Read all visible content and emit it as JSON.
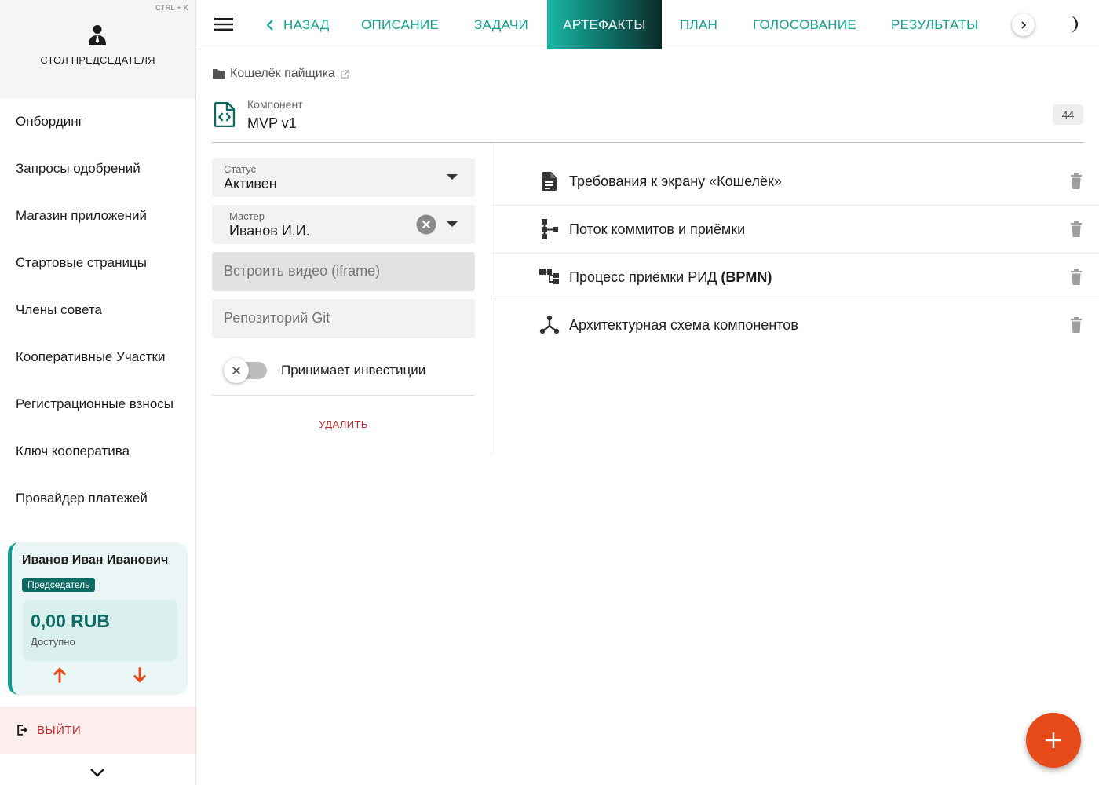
{
  "colors": {
    "accent": "#11a393",
    "accent_dark": "#0d6b63",
    "danger": "#c62828",
    "fab": "#e64a19"
  },
  "sidebar": {
    "hotkey": "CTRL + K",
    "header_icon": "user-tie-icon",
    "title": "СТОЛ ПРЕДСЕДАТЕЛЯ",
    "items": [
      {
        "label": "Онбординг"
      },
      {
        "label": "Запросы одобрений"
      },
      {
        "label": "Магазин приложений"
      },
      {
        "label": "Стартовые страницы"
      },
      {
        "label": "Члены совета"
      },
      {
        "label": "Кооперативные Участки"
      },
      {
        "label": "Регистрационные взносы"
      },
      {
        "label": "Ключ кооператива"
      },
      {
        "label": "Провайдер платежей"
      }
    ],
    "user": {
      "name": "Иванов Иван Иванович",
      "role": "Председатель",
      "balance": "0,00 RUB",
      "balance_caption": "Доступно"
    },
    "logout_label": "ВЫЙТИ"
  },
  "topbar": {
    "tabs": [
      {
        "label": "НАЗАД"
      },
      {
        "label": "ОПИСАНИЕ"
      },
      {
        "label": "ЗАДАЧИ"
      },
      {
        "label": "АРТЕФАКТЫ",
        "active": true
      },
      {
        "label": "ПЛАН"
      },
      {
        "label": "ГОЛОСОВАНИЕ"
      },
      {
        "label": "РЕЗУЛЬТАТЫ"
      }
    ]
  },
  "breadcrumb": {
    "label": "Кошелёк пайщика"
  },
  "component": {
    "caption": "Компонент",
    "name": "MVP v1",
    "count": "44"
  },
  "form": {
    "status": {
      "label": "Статус",
      "value": "Активен"
    },
    "master": {
      "label": "Мастер",
      "value": "Иванов И.И."
    },
    "video": {
      "placeholder": "Встроить видео (iframe)"
    },
    "repo": {
      "placeholder": "Репозиторий Git"
    },
    "investments_label": "Принимает инвестиции",
    "investments_on": false,
    "delete_label": "УДАЛИТЬ"
  },
  "artifacts": [
    {
      "icon": "document-icon",
      "title": "Требования к экрану «Кошелёк»",
      "bold": ""
    },
    {
      "icon": "flow-icon",
      "title": "Поток коммитов и приёмки",
      "bold": ""
    },
    {
      "icon": "process-tree-icon",
      "title": "Процесс приёмки РИД ",
      "bold": "(BPMN)"
    },
    {
      "icon": "schema-icon",
      "title": "Архитектурная схема компонентов",
      "bold": ""
    }
  ]
}
